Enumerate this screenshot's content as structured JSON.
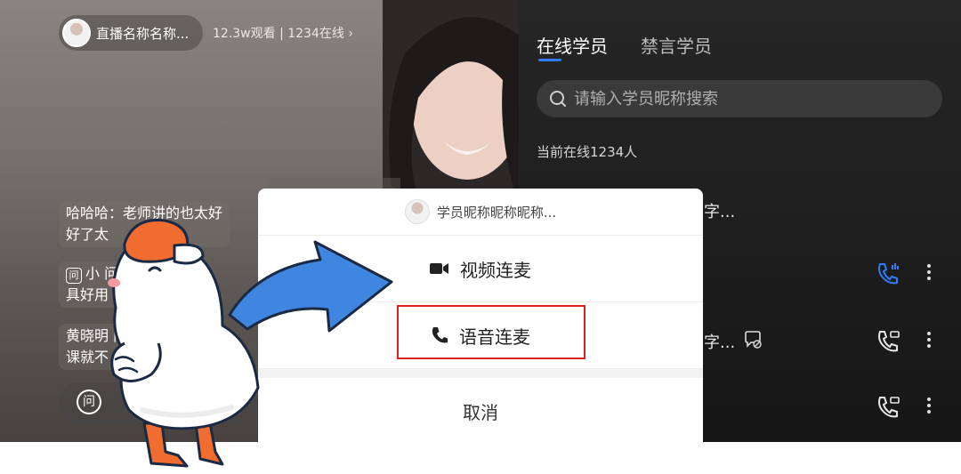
{
  "live": {
    "room_name": "直播名称名称...",
    "stats": "12.3w观看 | 1234在线 ›",
    "messages": [
      {
        "line1": "哈哈哈：老师讲的也太好",
        "line2": "好了太"
      },
      {
        "line1": "小     问小",
        "line2": "具好用"
      },
      {
        "line1": "黄晓明     问学",
        "line2": "课就不     个标"
      }
    ],
    "ask_label": "问"
  },
  "panel": {
    "tabs": [
      "在线学员",
      "禁言学员"
    ],
    "search_placeholder": "请输入学员昵称搜索",
    "online_count": "当前在线1234人",
    "students": [
      {
        "name": "字..."
      },
      {
        "name": ""
      },
      {
        "name": "字..."
      },
      {
        "name": ""
      }
    ]
  },
  "sheet": {
    "title": "学员昵称昵称昵称...",
    "video_label": "视频连麦",
    "voice_label": "语音连麦",
    "cancel_label": "取消"
  },
  "colors": {
    "accent_blue": "#2f7cf6",
    "highlight_red": "#e0201f",
    "panel_bg": "#1f1f1f"
  }
}
